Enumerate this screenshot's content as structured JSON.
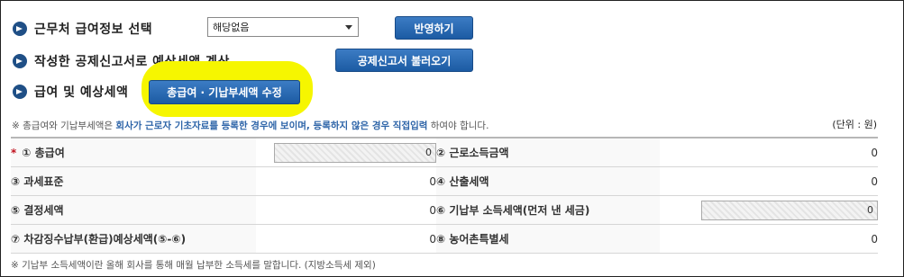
{
  "section1": {
    "label": "근무처 급여정보 선택",
    "select_value": "해당없음",
    "apply_button": "반영하기"
  },
  "section2": {
    "label": "작성한 공제신고서로 예상세액 계산",
    "load_button": "공제신고서 불러오기"
  },
  "section3": {
    "label": "급여 및 예상세액",
    "edit_button": "총급여 · 기납부세액 수정"
  },
  "notice": {
    "prefix": "※ 총급여와 기납부세액은 ",
    "highlight": "회사가 근로자 기초자료를 등록한 경우에 보이며, 등록하지 않은 경우 직접입력",
    "suffix": " 하여야 합니다."
  },
  "unit": "(단위 : 원)",
  "items": {
    "r1": {
      "star": "*",
      "l1": "① 총급여",
      "v1": "0",
      "l2": "② 근로소득금액",
      "v2": "0"
    },
    "r2": {
      "l1": "③ 과세표준",
      "v1": "0",
      "l2": "④ 산출세액",
      "v2": "0"
    },
    "r3": {
      "l1": "⑤ 결정세액",
      "v1": "0",
      "l2": "⑥ 기납부 소득세액(먼저 낸 세금)",
      "v2": "0"
    },
    "r4": {
      "l1": "⑦ 차감징수납부(환급)예상세액(⑤-⑥)",
      "v1": "0",
      "l2": "⑧ 농어촌특별세",
      "v2": "0"
    }
  },
  "footnote": "※ 기납부 소득세액이란 올해 회사를 통해 매월 납부한 소득세를 말합니다. (지방소득세 제외)",
  "colors": {
    "button": "#1c5ba3",
    "highlight": "#f6f600",
    "accent_text": "#2d64a8",
    "required_star": "#c1121f"
  }
}
